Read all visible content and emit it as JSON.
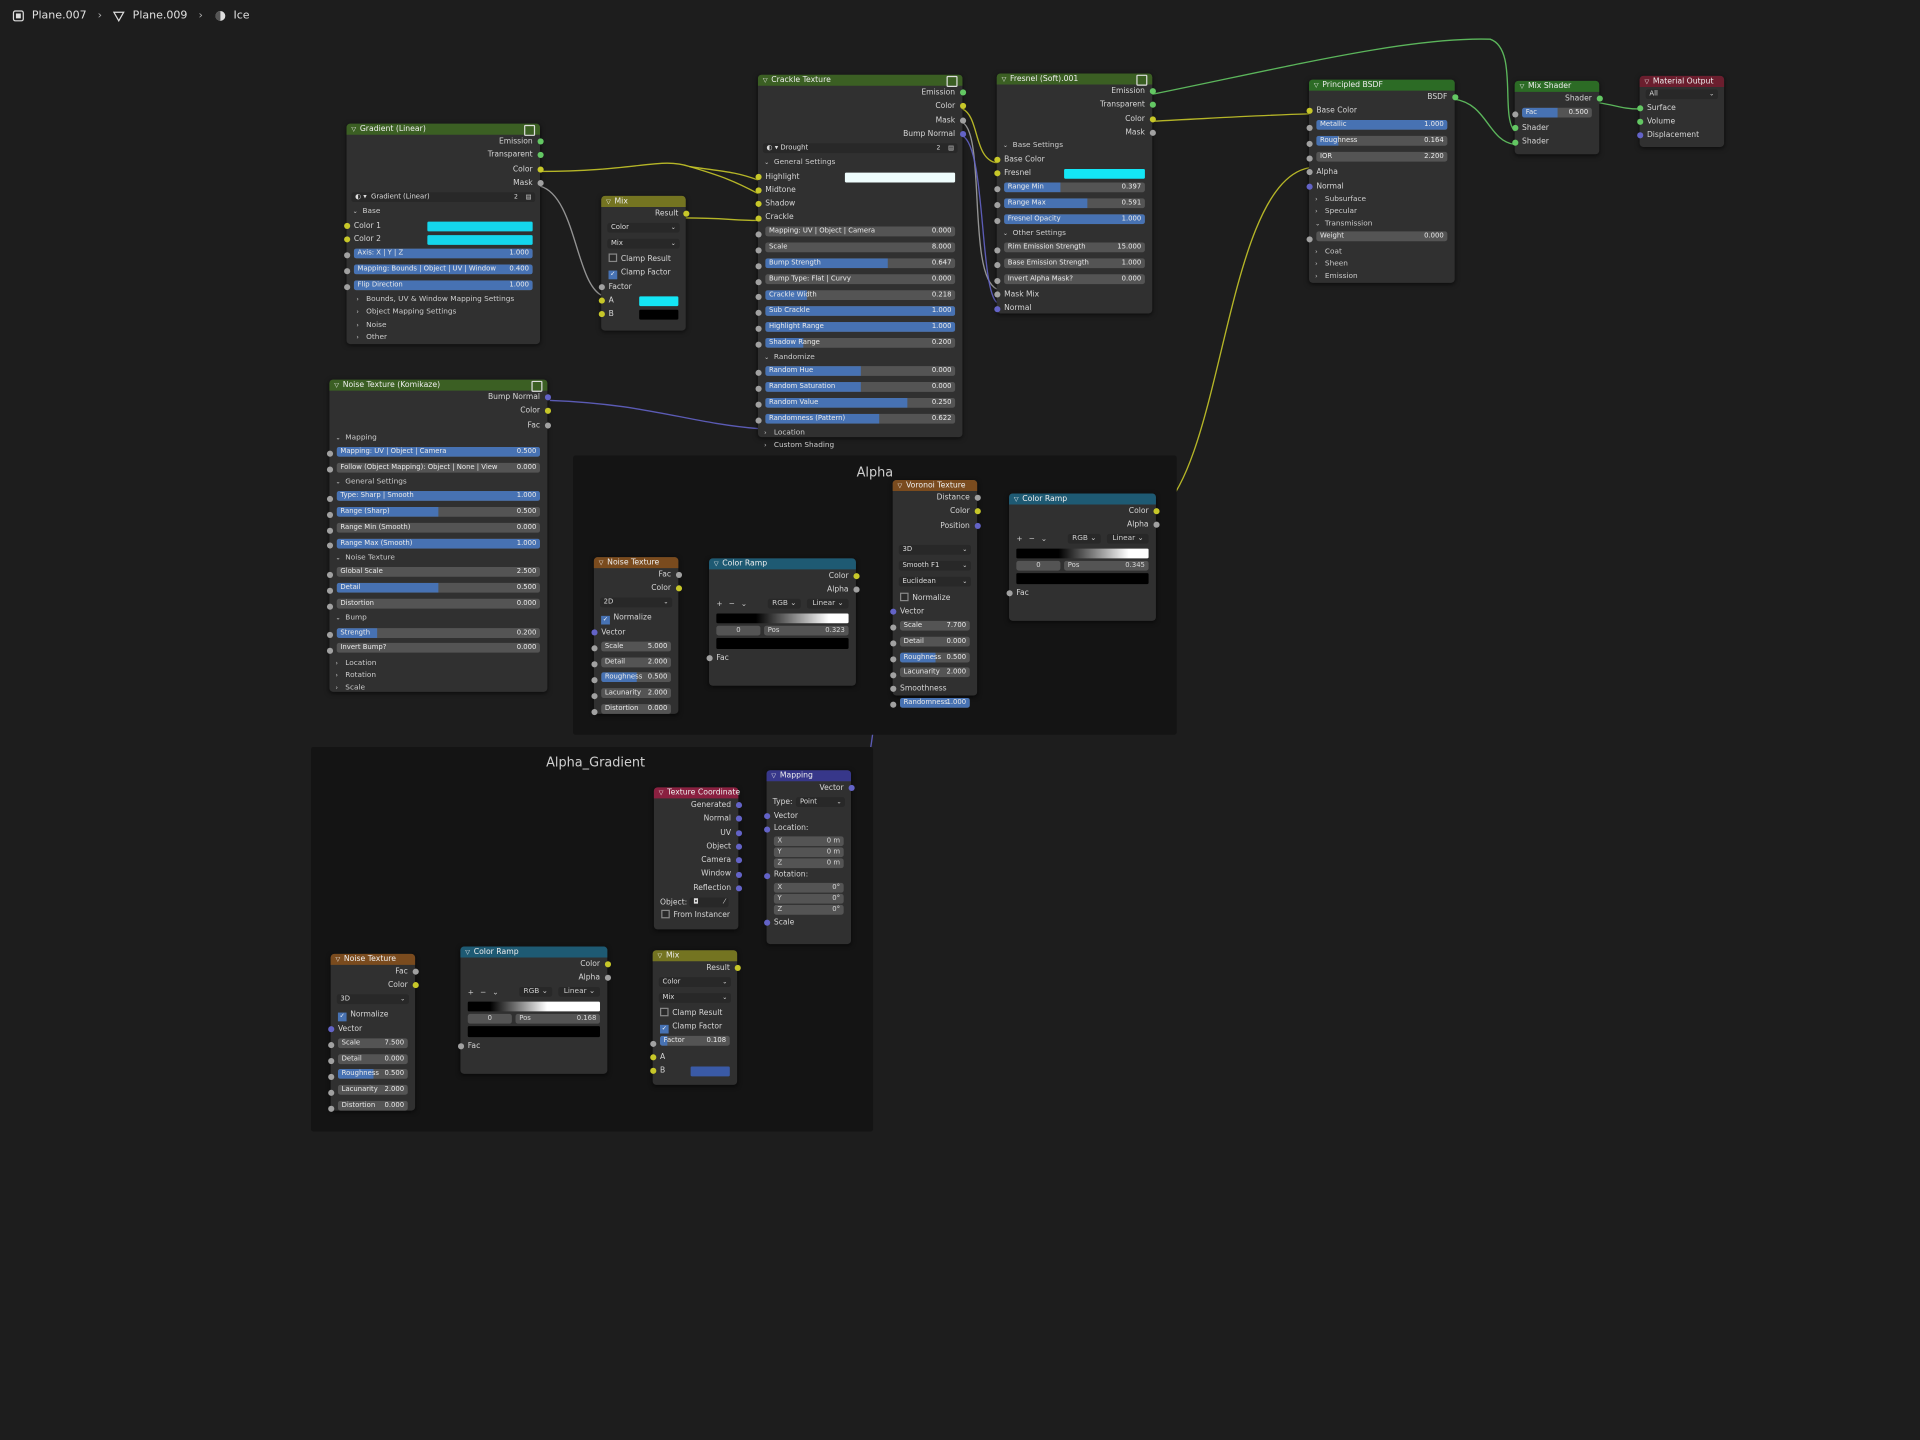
{
  "breadcrumb": {
    "object": "Plane.007",
    "mesh": "Plane.009",
    "material": "Ice"
  },
  "frames": {
    "alpha": "Alpha",
    "alpha_gradient": "Alpha_Gradient"
  },
  "gradient_linear": {
    "title": "Gradient (Linear)",
    "outs": [
      "Emission",
      "Transparent",
      "Color",
      "Mask"
    ],
    "group_name": "Gradient (Linear)",
    "users": "2",
    "base": "Base",
    "color1": "Color 1",
    "color2": "Color 2",
    "axis": {
      "label": "Axis: X | Y | Z",
      "value": "1.000"
    },
    "mapping": {
      "label": "Mapping: Bounds | Object | UV | Window",
      "value": "0.400"
    },
    "flip": {
      "label": "Flip Direction",
      "value": "1.000"
    },
    "panels": [
      "Bounds, UV & Window Mapping Settings",
      "Object Mapping Settings",
      "Noise",
      "Other"
    ]
  },
  "mix_top": {
    "title": "Mix",
    "result": "Result",
    "type": "Color",
    "blend": "Mix",
    "clamp_result": "Clamp Result",
    "clamp_factor": "Clamp Factor",
    "factor": "Factor",
    "a": "A",
    "b": "B"
  },
  "crackle": {
    "title": "Crackle Texture",
    "outs": [
      "Emission",
      "Color",
      "Mask",
      "Bump Normal"
    ],
    "group_name": "Drought",
    "users": "2",
    "general": "General Settings",
    "ins": [
      "Highlight",
      "Midtone",
      "Shadow",
      "Crackle"
    ],
    "sliders": [
      {
        "label": "Mapping: UV | Object | Camera",
        "value": "0.000",
        "fill": 0
      },
      {
        "label": "Scale",
        "value": "8.000",
        "fill": 0
      },
      {
        "label": "Bump Strength",
        "value": "0.647",
        "fill": 0.647
      },
      {
        "label": "Bump Type: Flat | Curvy",
        "value": "0.000",
        "fill": 0
      },
      {
        "label": "Crackle Width",
        "value": "0.218",
        "fill": 0.218
      },
      {
        "label": "Sub Crackle",
        "value": "1.000",
        "fill": 1
      },
      {
        "label": "Highlight Range",
        "value": "1.000",
        "fill": 1
      },
      {
        "label": "Shadow Range",
        "value": "0.200",
        "fill": 0.2
      }
    ],
    "randomize": "Randomize",
    "rsliders": [
      {
        "label": "Random Hue",
        "value": "0.000",
        "fill": 0.5
      },
      {
        "label": "Random Saturation",
        "value": "0.000",
        "fill": 0.5
      },
      {
        "label": "Random Value",
        "value": "0.250",
        "fill": 0.75
      },
      {
        "label": "Randomness (Pattern)",
        "value": "0.622",
        "fill": 0.6
      }
    ],
    "location": "Location",
    "custom": "Custom Shading"
  },
  "fresnel": {
    "title": "Fresnel (Soft).001",
    "outs": [
      "Emission",
      "Transparent",
      "Color",
      "Mask"
    ],
    "base": "Base Settings",
    "base_color": "Base Color",
    "fresnel": "Fresnel",
    "sliders": [
      {
        "label": "Range Min",
        "value": "0.397",
        "fill": 0.4
      },
      {
        "label": "Range Max",
        "value": "0.591",
        "fill": 0.59
      },
      {
        "label": "Fresnel Opacity",
        "value": "1.000",
        "fill": 1
      }
    ],
    "other": "Other Settings",
    "osliders": [
      {
        "label": "Rim Emission Strength",
        "value": "15.000",
        "fill": 0
      },
      {
        "label": "Base Emission Strength",
        "value": "1.000",
        "fill": 0
      },
      {
        "label": "Invert Alpha Mask?",
        "value": "0.000",
        "fill": 0
      }
    ],
    "mask_mix": "Mask Mix",
    "normal": "Normal"
  },
  "principled": {
    "title": "Principled BSDF",
    "out": "BSDF",
    "base_color": "Base Color",
    "sliders": [
      {
        "label": "Metallic",
        "value": "1.000",
        "fill": 1
      },
      {
        "label": "Roughness",
        "value": "0.164",
        "fill": 0.164
      },
      {
        "label": "IOR",
        "value": "2.200",
        "fill": 0
      }
    ],
    "alpha": "Alpha",
    "normal": "Normal",
    "panels1": [
      "Subsurface",
      "Specular"
    ],
    "transmission": "Transmission",
    "weight": {
      "label": "Weight",
      "value": "0.000"
    },
    "panels2": [
      "Coat",
      "Sheen",
      "Emission"
    ]
  },
  "mix_shader": {
    "title": "Mix Shader",
    "out": "Shader",
    "fac": {
      "label": "Fac",
      "value": "0.500"
    },
    "in1": "Shader",
    "in2": "Shader"
  },
  "output": {
    "title": "Material Output",
    "target": "All",
    "ins": [
      "Surface",
      "Volume",
      "Displacement"
    ]
  },
  "noise_komi": {
    "title": "Noise Texture (Komikaze)",
    "outs": [
      "Bump Normal",
      "Color",
      "Fac"
    ],
    "mapping": "Mapping",
    "m1": [
      {
        "label": "Mapping: UV | Object | Camera",
        "value": "0.500",
        "fill": 1
      },
      {
        "label": "Follow (Object Mapping): Object | None | View",
        "value": "0.000",
        "fill": 0
      }
    ],
    "general": "General Settings",
    "m2": [
      {
        "label": "Type: Sharp | Smooth",
        "value": "1.000",
        "fill": 1
      },
      {
        "label": "Range (Sharp)",
        "value": "0.500",
        "fill": 0.5
      },
      {
        "label": "Range Min (Smooth)",
        "value": "0.000",
        "fill": 0
      },
      {
        "label": "Range Max (Smooth)",
        "value": "1.000",
        "fill": 1
      }
    ],
    "noise": "Noise Texture",
    "m3": [
      {
        "label": "Global Scale",
        "value": "2.500",
        "fill": 0
      },
      {
        "label": "Detail",
        "value": "0.500",
        "fill": 0.5
      },
      {
        "label": "Distortion",
        "value": "0.000",
        "fill": 0
      }
    ],
    "bump": "Bump",
    "m4": [
      {
        "label": "Strength",
        "value": "0.200",
        "fill": 0.2
      },
      {
        "label": "Invert Bump?",
        "value": "0.000",
        "fill": 0
      }
    ],
    "panels": [
      "Location",
      "Rotation",
      "Scale"
    ]
  },
  "noise_alpha": {
    "title": "Noise Texture",
    "outs": [
      "Fac",
      "Color"
    ],
    "dim": "2D",
    "normalize": "Normalize",
    "vector": "Vector",
    "fields": [
      {
        "label": "Scale",
        "value": "5.000",
        "fill": 0
      },
      {
        "label": "Detail",
        "value": "2.000",
        "fill": 0
      },
      {
        "label": "Roughness",
        "value": "0.500",
        "fill": 0.5
      },
      {
        "label": "Lacunarity",
        "value": "2.000",
        "fill": 0
      },
      {
        "label": "Distortion",
        "value": "0.000",
        "fill": 0
      }
    ]
  },
  "ramp_alpha": {
    "title": "Color Ramp",
    "outs": [
      "Color",
      "Alpha"
    ],
    "mode": "RGB",
    "interp": "Linear",
    "index": "0",
    "pos_label": "Pos",
    "pos": "0.323",
    "fac": "Fac"
  },
  "voronoi": {
    "title": "Voronoi Texture",
    "outs": [
      "Distance",
      "Color",
      "Position"
    ],
    "dim": "3D",
    "feature": "Smooth F1",
    "metric": "Euclidean",
    "normalize": "Normalize",
    "vector": "Vector",
    "fields": [
      {
        "label": "Scale",
        "value": "7.700",
        "fill": 0
      },
      {
        "label": "Detail",
        "value": "0.000",
        "fill": 0
      },
      {
        "label": "Roughness",
        "value": "0.500",
        "fill": 0.5
      },
      {
        "label": "Lacunarity",
        "value": "2.000",
        "fill": 0
      }
    ],
    "smoothness": "Smoothness",
    "random": {
      "label": "Randomness",
      "value": "1.000",
      "fill": 1
    }
  },
  "ramp_voronoi": {
    "title": "Color Ramp",
    "outs": [
      "Color",
      "Alpha"
    ],
    "mode": "RGB",
    "interp": "Linear",
    "index": "0",
    "pos_label": "Pos",
    "pos": "0.345",
    "fac": "Fac"
  },
  "texcoord": {
    "title": "Texture Coordinate",
    "outs": [
      "Generated",
      "Normal",
      "UV",
      "Object",
      "Camera",
      "Window",
      "Reflection"
    ],
    "object": "Object:",
    "instancer": "From Instancer"
  },
  "mapping": {
    "title": "Mapping",
    "out": "Vector",
    "type_label": "Type:",
    "type": "Point",
    "vector": "Vector",
    "location": "Location:",
    "loc": [
      {
        "a": "X",
        "v": "0 m"
      },
      {
        "a": "Y",
        "v": "0 m"
      },
      {
        "a": "Z",
        "v": "0 m"
      }
    ],
    "rotation": "Rotation:",
    "rot": [
      {
        "a": "X",
        "v": "0°"
      },
      {
        "a": "Y",
        "v": "0°"
      },
      {
        "a": "Z",
        "v": "0°"
      }
    ],
    "scale": "Scale"
  },
  "noise_grad": {
    "title": "Noise Texture",
    "outs": [
      "Fac",
      "Color"
    ],
    "dim": "3D",
    "normalize": "Normalize",
    "vector": "Vector",
    "fields": [
      {
        "label": "Scale",
        "value": "7.500",
        "fill": 0
      },
      {
        "label": "Detail",
        "value": "0.000",
        "fill": 0
      },
      {
        "label": "Roughness",
        "value": "0.500",
        "fill": 0.5
      },
      {
        "label": "Lacunarity",
        "value": "2.000",
        "fill": 0
      },
      {
        "label": "Distortion",
        "value": "0.000",
        "fill": 0
      }
    ]
  },
  "ramp_grad": {
    "title": "Color Ramp",
    "outs": [
      "Color",
      "Alpha"
    ],
    "mode": "RGB",
    "interp": "Linear",
    "index": "0",
    "pos_label": "Pos",
    "pos": "0.168",
    "fac": "Fac"
  },
  "mix_grad": {
    "title": "Mix",
    "result": "Result",
    "type": "Color",
    "blend": "Mix",
    "clamp_result": "Clamp Result",
    "clamp_factor": "Clamp Factor",
    "factor": {
      "label": "Factor",
      "value": "0.108",
      "fill": 0.108
    },
    "a": "A",
    "b": "B"
  },
  "colors": {
    "texture": "#7a4b1e",
    "converter": "#1e5a73",
    "shader": "#2c6b25",
    "output": "#6b1e2e",
    "group": "#3b5f23",
    "vector": "#37378a",
    "input": "#8a2040",
    "mix": "#747421",
    "accent": "#4772b3",
    "cyan": "#14e6f5",
    "sock_yellow": "#c7c729",
    "sock_grey": "#a1a1a1",
    "sock_purple": "#6363c7",
    "sock_green": "#63c763"
  }
}
